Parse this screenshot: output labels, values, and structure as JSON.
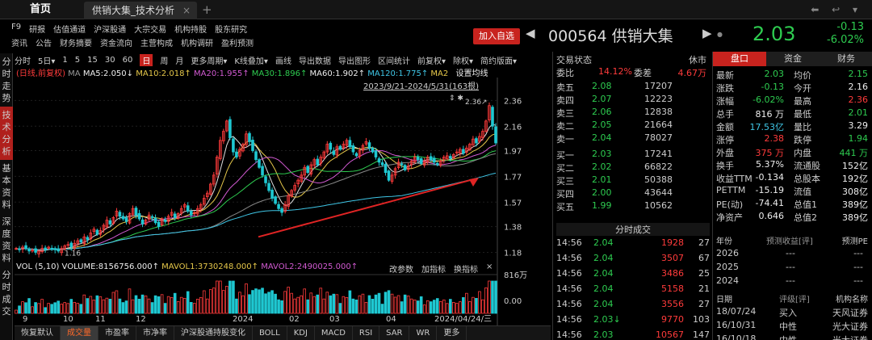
{
  "tabs": {
    "home": "首页",
    "active": "供销大集_技术分析",
    "close": "×",
    "add": "+"
  },
  "window_controls": "⬅ ↩ ▾",
  "menu": {
    "row1": [
      "F9",
      "研报",
      "估值通道",
      "沪深股通",
      "大宗交易",
      "机构持股",
      "股东研究"
    ],
    "row2": [
      "资讯",
      "公告",
      "财务摘要",
      "资金流向",
      "主营构成",
      "机构调研",
      "盈利预测"
    ]
  },
  "quote": {
    "add_fav": "加入自选",
    "prev": "◀",
    "next": "▶",
    "code_name": "000564 供销大集",
    "price": "2.03",
    "change": "-0.13",
    "change_pct": "-6.02%"
  },
  "left_nav": [
    {
      "label": "分时走势",
      "active": false
    },
    {
      "label": "技术分析",
      "active": true
    },
    {
      "label": "基本资料",
      "active": false
    },
    {
      "label": "深度资料",
      "active": false
    },
    {
      "label": "分时成交",
      "active": false
    }
  ],
  "toolbar": {
    "items": [
      "分时",
      "5日▾",
      "1",
      "5",
      "15",
      "30",
      "60",
      "日",
      "周",
      "月",
      "更多周期▾",
      "K线叠加▾",
      "画线",
      "导出数据",
      "导出图形",
      "区间统计",
      "前复权▾",
      "除权▾",
      "简约版面▾"
    ],
    "active": "日"
  },
  "indicators": {
    "mode": "(日线,前复权)",
    "ma": "MA",
    "ma5": "MA5:2.050↓",
    "ma10": "MA10:2.018↑",
    "ma20": "MA20:1.955↑",
    "ma30": "MA30:1.896↑",
    "ma60": "MA60:1.902↑",
    "ma120": "MA120:1.775↑",
    "ma2": "MA2",
    "setting": "设置均线"
  },
  "date_range": "2023/9/21-2024/5/31(163根)",
  "chart_icons": "⇕ ✱",
  "chart_data": {
    "type": "candlestick",
    "y_ticks": [
      "2.36",
      "2.16",
      "1.97",
      "1.77",
      "1.57",
      "1.38",
      "1.18"
    ],
    "high_label": "2.36↗",
    "low_label": "1.16",
    "x_ticks": [
      "9",
      "10",
      "11",
      "12",
      "2024",
      "02",
      "03",
      "04",
      "2024/04/24/三"
    ],
    "vol_ticks": [
      "816万",
      "0.00"
    ],
    "closes": [
      1.21,
      1.2,
      1.22,
      1.21,
      1.19,
      1.2,
      1.18,
      1.19,
      1.21,
      1.2,
      1.22,
      1.21,
      1.2,
      1.19,
      1.21,
      1.23,
      1.24,
      1.22,
      1.25,
      1.27,
      1.26,
      1.3,
      1.28,
      1.33,
      1.36,
      1.32,
      1.35,
      1.39,
      1.43,
      1.4,
      1.45,
      1.5,
      1.46,
      1.44,
      1.42,
      1.48,
      1.52,
      1.47,
      1.44,
      1.4,
      1.43,
      1.47,
      1.45,
      1.41,
      1.38,
      1.44,
      1.42,
      1.46,
      1.49,
      1.45,
      1.48,
      1.52,
      1.55,
      1.5,
      1.47,
      1.49,
      1.52,
      1.55,
      1.6,
      1.64,
      1.71,
      1.78,
      1.92,
      2.05,
      2.12,
      2.2,
      2.07,
      1.96,
      1.92,
      1.98,
      2.02,
      2.1,
      2.04,
      1.97,
      1.9,
      1.84,
      1.78,
      1.72,
      1.66,
      1.6,
      1.56,
      1.52,
      1.49,
      1.55,
      1.62,
      1.66,
      1.7,
      1.74,
      1.78,
      1.84,
      1.8,
      1.86,
      1.9,
      1.86,
      1.92,
      1.96,
      2.02,
      1.98,
      1.94,
      2.0,
      1.98,
      2.02,
      2.05,
      2.0,
      1.96,
      1.93,
      1.97,
      2.01,
      2.04,
      1.99,
      1.96,
      1.92,
      1.88,
      1.86,
      1.8,
      1.74,
      1.78,
      1.83,
      1.88,
      1.86,
      1.82,
      1.85,
      1.89,
      1.92,
      1.9,
      1.87,
      1.89,
      1.92,
      1.9,
      1.88,
      1.86,
      1.89,
      1.92,
      1.93,
      1.91,
      1.94,
      1.96,
      1.98,
      1.95,
      1.99,
      2.02,
      2.06,
      2.03,
      2.08,
      2.12,
      2.2,
      2.32,
      2.16,
      2.03
    ]
  },
  "volume": {
    "label": "VOL (5,10)",
    "v": "VOLUME:8156756.000↑",
    "m1": "MAVOL1:3730248.000↑",
    "m2": "MAVOL2:2490025.000↑",
    "btns": [
      "改参数",
      "加指标",
      "换指标",
      "×"
    ]
  },
  "bottom_tabs": {
    "items": [
      "恢复默认",
      "成交量",
      "市盈率",
      "市净率",
      "沪深股通持股变化",
      "BOLL",
      "KDJ",
      "MACD",
      "RSI",
      "SAR",
      "WR",
      "更多"
    ],
    "active": "成交量"
  },
  "orderbook": {
    "title": "交易状态",
    "status": "休市",
    "wb_label": "委比",
    "wb": "14.12%",
    "wc_label": "委差",
    "wc": "4.67万",
    "sells": [
      {
        "l": "卖五",
        "p": "2.08",
        "v": "17207"
      },
      {
        "l": "卖四",
        "p": "2.07",
        "v": "12223"
      },
      {
        "l": "卖三",
        "p": "2.06",
        "v": "12838"
      },
      {
        "l": "卖二",
        "p": "2.05",
        "v": "21664"
      },
      {
        "l": "卖一",
        "p": "2.04",
        "v": "78027"
      }
    ],
    "buys": [
      {
        "l": "买一",
        "p": "2.03",
        "v": "17241"
      },
      {
        "l": "买二",
        "p": "2.02",
        "v": "66822"
      },
      {
        "l": "买三",
        "p": "2.01",
        "v": "50388"
      },
      {
        "l": "买四",
        "p": "2.00",
        "v": "43644"
      },
      {
        "l": "买五",
        "p": "1.99",
        "v": "10562"
      }
    ],
    "ticks_title": "分时成交",
    "ticks": [
      {
        "t": "14:56",
        "p": "2.04",
        "v": "1928",
        "n": "27"
      },
      {
        "t": "14:56",
        "p": "2.04",
        "v": "3507",
        "n": "67"
      },
      {
        "t": "14:56",
        "p": "2.04",
        "v": "3486",
        "n": "25"
      },
      {
        "t": "14:56",
        "p": "2.04",
        "v": "5158",
        "n": "21"
      },
      {
        "t": "14:56",
        "p": "2.04",
        "v": "3556",
        "n": "27"
      },
      {
        "t": "14:56",
        "p": "2.03↓",
        "v": "9770",
        "n": "103"
      },
      {
        "t": "14:56",
        "p": "2.03",
        "v": "10567",
        "n": "147"
      }
    ]
  },
  "fund": {
    "tabs": [
      "盘口",
      "资金",
      "财务"
    ],
    "active": "盘口",
    "rows": [
      {
        "l1": "最新",
        "v1": "2.03",
        "l2": "均价",
        "v2": "2.15",
        "c1": "green",
        "c2": "green"
      },
      {
        "l1": "涨跌",
        "v1": "-0.13",
        "l2": "今开",
        "v2": "2.16",
        "c1": "green",
        "c2": "white"
      },
      {
        "l1": "涨幅",
        "v1": "-6.02%",
        "l2": "最高",
        "v2": "2.36",
        "c1": "green",
        "c2": "red"
      },
      {
        "l1": "总手",
        "v1": "816 万",
        "l2": "最低",
        "v2": "2.01",
        "c1": "white",
        "c2": "green"
      },
      {
        "l1": "金额",
        "v1": "17.53亿",
        "l2": "量比",
        "v2": "3.29",
        "c1": "cyan",
        "c2": "white"
      },
      {
        "l1": "涨停",
        "v1": "2.38",
        "l2": "跌停",
        "v2": "1.94",
        "c1": "red",
        "c2": "green"
      },
      {
        "l1": "外盘",
        "v1": "375 万",
        "l2": "内盘",
        "v2": "441 万",
        "c1": "red",
        "c2": "green"
      },
      {
        "l1": "换手",
        "v1": "5.37%",
        "l2": "流通股",
        "v2": "152亿",
        "c1": "white",
        "c2": "white"
      },
      {
        "l1": "收益TTM",
        "v1": "-0.134",
        "l2": "总股本",
        "v2": "192亿",
        "c1": "white",
        "c2": "white"
      },
      {
        "l1": "PETTM",
        "v1": "-15.19",
        "l2": "流值",
        "v2": "308亿",
        "c1": "white",
        "c2": "white"
      },
      {
        "l1": "PE(动)",
        "v1": "-74.41",
        "l2": "总值1",
        "v2": "389亿",
        "c1": "white",
        "c2": "white"
      },
      {
        "l1": "净资产",
        "v1": "0.646",
        "l2": "总值2",
        "v2": "389亿",
        "c1": "white",
        "c2": "white"
      }
    ],
    "fc_head": [
      "年份",
      "预测收益[评]",
      "预测PE"
    ],
    "fc": [
      {
        "y": "2026",
        "e": "---",
        "p": "---"
      },
      {
        "y": "2025",
        "e": "---",
        "p": "---"
      },
      {
        "y": "2024",
        "e": "---",
        "p": "---"
      }
    ],
    "rt_head": [
      "日期",
      "评级[评]",
      "机构名称"
    ],
    "rt": [
      {
        "d": "18/07/24",
        "r": "买入",
        "o": "天风证券"
      },
      {
        "d": "16/10/31",
        "r": "中性",
        "o": "光大证券"
      },
      {
        "d": "16/10/18",
        "r": "中性",
        "o": "光大证券"
      }
    ]
  }
}
